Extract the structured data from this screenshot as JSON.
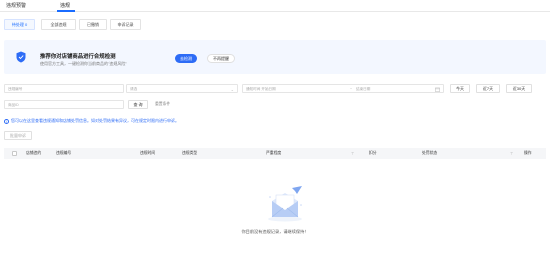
{
  "top_tabs": [
    {
      "label": "违规预警",
      "active": false
    },
    {
      "label": "违规",
      "active": true
    }
  ],
  "sub_tabs": [
    {
      "label": "待处理 0",
      "active": true
    },
    {
      "label": "全部违规",
      "active": false
    },
    {
      "label": "已撤销",
      "active": false
    },
    {
      "label": "申诉记录",
      "active": false
    }
  ],
  "banner": {
    "title": "推荐你对店铺商品进行合规检测",
    "desc": "使用官方工具，一键检测你当前商品的\"违规风险\"",
    "primary_label": "去检测",
    "ghost_label": "不再提醒",
    "shield_icon": "shield-icon"
  },
  "filters": {
    "violation_no_placeholder": "违规编号",
    "type_placeholder": "请选",
    "start_date_placeholder": "通知时间  开始日期",
    "end_date_placeholder": "结束日期",
    "date_separator": "~",
    "today_label": "今天",
    "last7_label": "近7天",
    "last30_label": "近30天",
    "product_id_placeholder": "商品ID",
    "query_label": "查 询",
    "reset_label": "重置条件"
  },
  "notice": {
    "text": "您可以在这里查看违规通知和店铺处罚信息。如对处罚结果有异议，可在规定时限内进行申诉。"
  },
  "batch_label": "批量申诉",
  "table": {
    "columns": [
      "店铺违约",
      "违规编号",
      "违规时间",
      "违规类型",
      "严重程度",
      "扣分",
      "处罚状态",
      "操作"
    ]
  },
  "empty": {
    "text": "你目前没有违规记录，请继续保持！"
  },
  "colors": {
    "accent": "#2d6cf6",
    "banner_bg": "#f3f7ff",
    "table_head_bg": "#f5f6f8"
  }
}
